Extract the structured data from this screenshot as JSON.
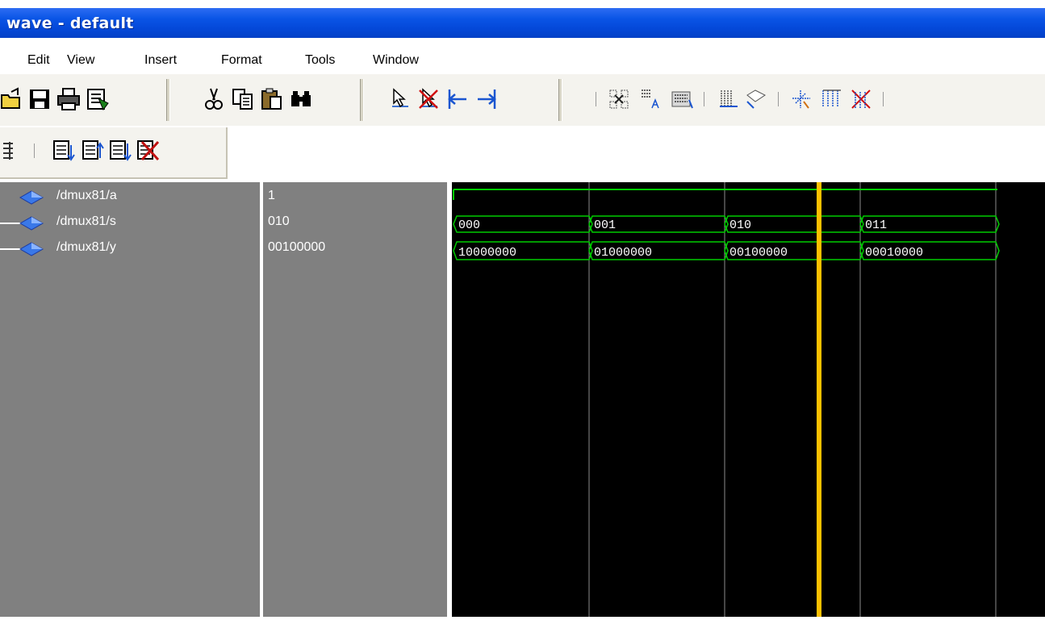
{
  "window": {
    "title": "wave - default"
  },
  "menu": [
    "Edit",
    "View",
    "Insert",
    "Format",
    "Tools",
    "Window"
  ],
  "toolbar": {
    "row1_icons": [
      "open-icon",
      "save-icon",
      "print-icon",
      "compile-icon",
      "cut-icon",
      "copy-icon",
      "paste-icon",
      "find-icon",
      "select-pointer-icon",
      "zoom-mode-icon",
      "cursor-left-icon",
      "cursor-right-icon",
      "zoom-in-icon",
      "zoom-out-icon",
      "zoom-full-icon",
      "insert-cursor-icon",
      "delete-cursor-icon",
      "find-previous-edge-icon",
      "find-next-edge-icon",
      "stop-icon"
    ],
    "row2_icons": [
      "expand-icon",
      "step-icon",
      "step-over-icon",
      "continue-icon",
      "break-icon"
    ]
  },
  "signals": [
    {
      "name": "/dmux81/a",
      "value": "1"
    },
    {
      "name": "/dmux81/s",
      "value": "010"
    },
    {
      "name": "/dmux81/y",
      "value": "00100000"
    }
  ],
  "waveform": {
    "s_segments": [
      "000",
      "001",
      "010",
      "011"
    ],
    "y_segments": [
      "10000000",
      "01000000",
      "00100000",
      "00010000"
    ],
    "cursor_color": "#ffc000",
    "signal_color": "#00cc00",
    "grid_color": "#8c8c8c"
  }
}
